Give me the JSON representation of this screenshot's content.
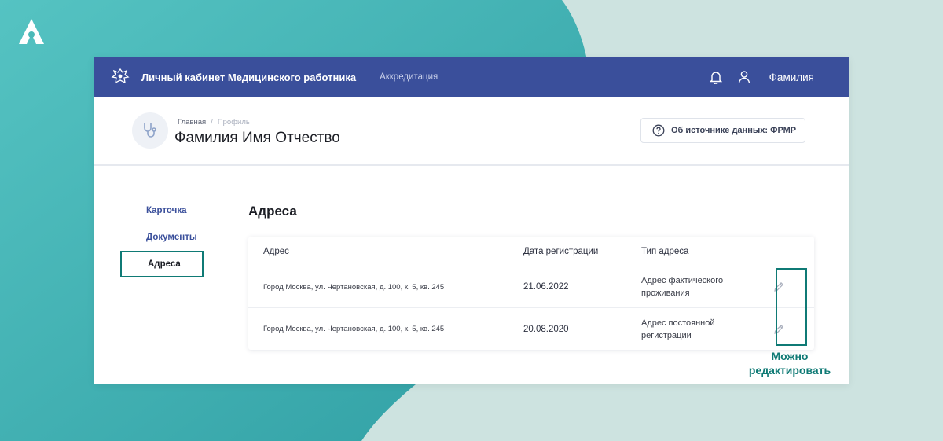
{
  "topbar": {
    "app_title": "Личный кабинет Медицинского работника",
    "nav_link": "Аккредитация",
    "user_name": "Фамилия"
  },
  "header": {
    "breadcrumb": [
      "Главная",
      "Профиль"
    ],
    "page_title": "Фамилия Имя Отчество",
    "source_button": "Об источнике данных: ФРМР"
  },
  "sidebar": {
    "items": [
      {
        "label": "Карточка",
        "active": false
      },
      {
        "label": "Документы",
        "active": false
      },
      {
        "label": "Адреса",
        "active": true
      }
    ]
  },
  "main": {
    "section_title": "Адреса",
    "table": {
      "columns": [
        "Адрес",
        "Дата регистрации",
        "Тип адреса"
      ],
      "rows": [
        {
          "address": "Город Москва, ул. Чертановская, д. 100, к. 5, кв. 245",
          "date": "21.06.2022",
          "type": "Адрес фактического проживания"
        },
        {
          "address": "Город Москва, ул. Чертановская, д. 100, к. 5, кв. 245",
          "date": "20.08.2020",
          "type": "Адрес постоянной регистрации"
        }
      ]
    }
  },
  "annotation": {
    "note_line1": "Можно",
    "note_line2": "редактировать"
  },
  "colors": {
    "topbar": "#3a4f9b",
    "accent_teal": "#0f7a75",
    "bg_teal": "#4bbab8",
    "bg_light": "#cde3e0"
  },
  "icons": {
    "logo": "brand-a-logo",
    "emblem": "coat-of-arms-icon",
    "bell": "bell-icon",
    "user": "user-icon",
    "avatar": "stethoscope-icon",
    "help": "question-circle-icon",
    "edit": "pencil-icon"
  }
}
